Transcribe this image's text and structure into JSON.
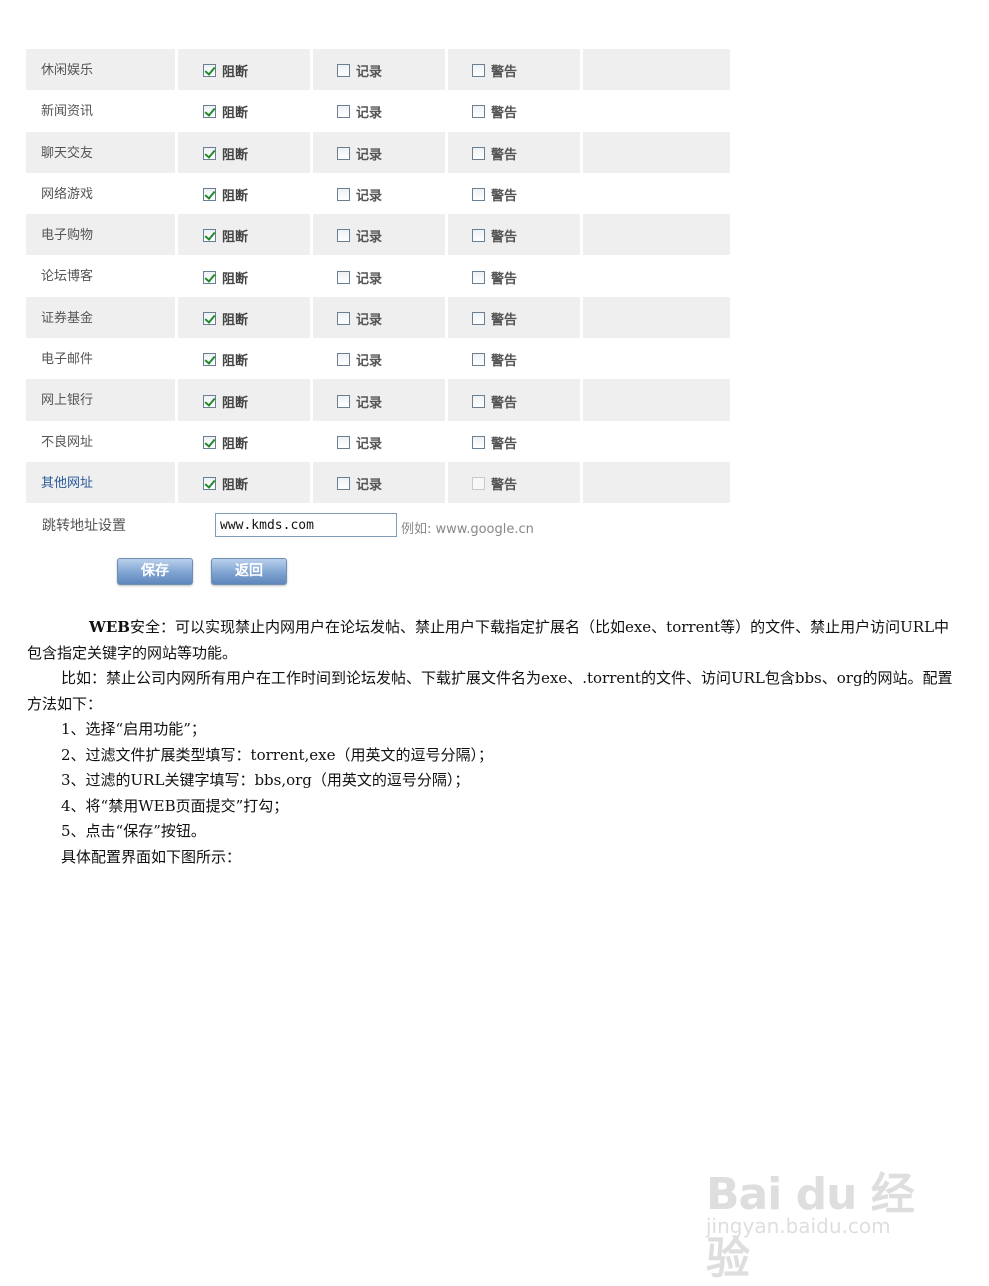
{
  "rules": [
    {
      "name": "休闲娱乐",
      "block": true,
      "log": false,
      "warn": false
    },
    {
      "name": "新闻资讯",
      "block": true,
      "log": false,
      "warn": false
    },
    {
      "name": "聊天交友",
      "block": true,
      "log": false,
      "warn": false
    },
    {
      "name": "网络游戏",
      "block": true,
      "log": false,
      "warn": false
    },
    {
      "name": "电子购物",
      "block": true,
      "log": false,
      "warn": false
    },
    {
      "name": "论坛博客",
      "block": true,
      "log": false,
      "warn": false
    },
    {
      "name": "证券基金",
      "block": true,
      "log": false,
      "warn": false
    },
    {
      "name": "电子邮件",
      "block": true,
      "log": false,
      "warn": false
    },
    {
      "name": "网上银行",
      "block": true,
      "log": false,
      "warn": false
    },
    {
      "name": "不良网址",
      "block": true,
      "log": false,
      "warn": false
    },
    {
      "name": "其他网址",
      "block": true,
      "log": false,
      "warn": false,
      "warn_disabled": true,
      "name_is_link": true
    }
  ],
  "option_labels": {
    "block": "阻断",
    "log": "记录",
    "warn": "警告"
  },
  "redirect": {
    "label": "跳转地址设置",
    "value": "www.kmds.com",
    "example": "例如: www.google.cn"
  },
  "buttons": {
    "save": "保存",
    "back": "返回"
  },
  "article": {
    "p1_bold": "WEB",
    "p1_rest": "安全：可以实现禁止内网用户在论坛发帖、禁止用户下载指定扩展名（比如exe、torrent等）的文件、禁止用户访问URL中包含指定关键字的网站等功能。",
    "p2": "比如：禁止公司内网所有用户在工作时间到论坛发帖、下载扩展文件名为exe、.torrent的文件、访问URL包含bbs、org的网站。配置方法如下：",
    "steps": [
      "1、选择“启用功能”；",
      "2、过滤文件扩展类型填写：torrent,exe（用英文的逗号分隔）；",
      "3、过滤的URL关键字填写：bbs,org（用英文的逗号分隔）；",
      "4、将“禁用WEB页面提交”打勾；",
      "5、点击“保存”按钮。"
    ],
    "p_last": "具体配置界面如下图所示："
  },
  "watermark": {
    "brand": "Bai du 经验",
    "url": "jingyan.baidu.com"
  },
  "colors": {
    "row_shade": "#efefef",
    "link": "#2a5a9c",
    "button": "#7fa3d1",
    "check": "#1f8a2a"
  }
}
